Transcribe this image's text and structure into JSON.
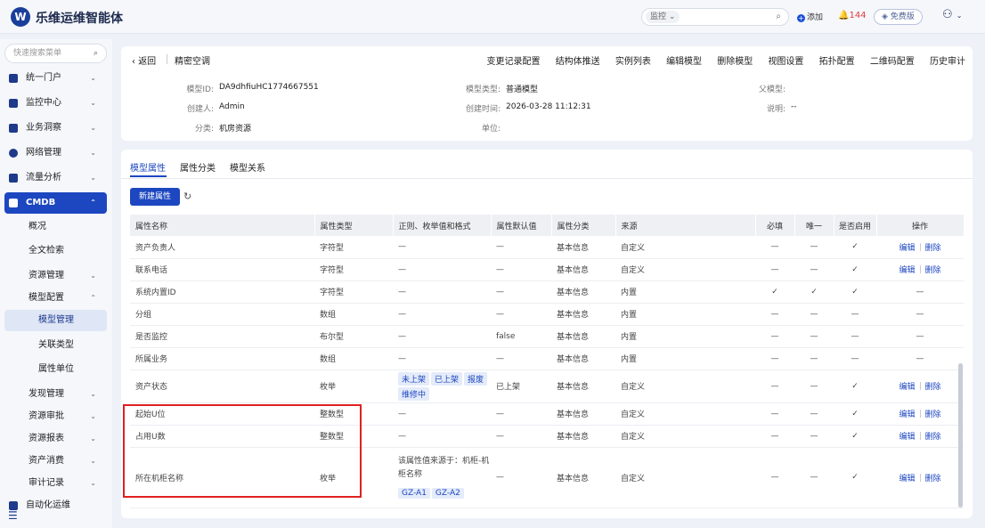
{
  "app": {
    "logo": "W",
    "title": "乐维运维智能体"
  },
  "topbar": {
    "search_select": "监控 ⌄",
    "add_label": "添加",
    "alarm_count": "144",
    "free_label": "免费版"
  },
  "sidebar": {
    "search_placeholder": "快速搜索菜单",
    "items": [
      "统一门户",
      "监控中心",
      "业务洞察",
      "网络管理",
      "流量分析",
      "CMDB"
    ],
    "sub_items": [
      "概况",
      "全文检索",
      "资源管理",
      "模型配置",
      "模型管理",
      "关联类型",
      "属性单位",
      "发现管理",
      "资源审批",
      "资源报表",
      "资产消费",
      "审计记录",
      "自动化运维"
    ]
  },
  "header": {
    "back_label": "返回",
    "title": "精密空调",
    "actions": [
      "变更记录配置",
      "结构体推送",
      "实例列表",
      "编辑模型",
      "删除模型",
      "视图设置",
      "拓扑配置",
      "二维码配置",
      "历史审计"
    ],
    "meta": {
      "model_id_label": "模型ID:",
      "model_id": "DA9dhfiuHC1774667551",
      "creator_label": "创建人:",
      "creator": "Admin",
      "category_label": "分类:",
      "category": "机房资源",
      "type_label": "模型类型:",
      "type": "普通模型",
      "created_label": "创建时间:",
      "created": "2026-03-28 11:12:31",
      "unit_label": "单位:",
      "unit": "",
      "parent_label": "父模型:",
      "parent": "",
      "desc_label": "说明:",
      "desc": "--"
    }
  },
  "tabs": [
    "模型属性",
    "属性分类",
    "模型关系"
  ],
  "new_button": "新建属性",
  "table": {
    "headers": [
      "属性名称",
      "属性类型",
      "正则、枚举值和格式",
      "属性默认值",
      "属性分类",
      "来源",
      "必填",
      "唯一",
      "是否启用",
      "操作"
    ],
    "rows": [
      {
        "name": "资产负责人",
        "type": "字符型",
        "format": "—",
        "default": "—",
        "category": "基本信息",
        "source": "自定义",
        "required": "—",
        "unique": "—",
        "enabled": "✓",
        "edit": "编辑",
        "del": "删除"
      },
      {
        "name": "联系电话",
        "type": "字符型",
        "format": "—",
        "default": "—",
        "category": "基本信息",
        "source": "自定义",
        "required": "—",
        "unique": "—",
        "enabled": "✓",
        "edit": "编辑",
        "del": "删除"
      },
      {
        "name": "系统内置ID",
        "type": "字符型",
        "format": "—",
        "default": "—",
        "category": "基本信息",
        "source": "内置",
        "required": "✓",
        "unique": "✓",
        "enabled": "✓",
        "edit": "",
        "del": "",
        "ops_dash": "—"
      },
      {
        "name": "分组",
        "type": "数组",
        "format": "—",
        "default": "—",
        "category": "基本信息",
        "source": "内置",
        "required": "—",
        "unique": "—",
        "enabled": "—",
        "edit": "",
        "del": "",
        "ops_dash": "—"
      },
      {
        "name": "是否监控",
        "type": "布尔型",
        "format": "—",
        "default": "false",
        "category": "基本信息",
        "source": "内置",
        "required": "—",
        "unique": "—",
        "enabled": "—",
        "edit": "",
        "del": "",
        "ops_dash": "—"
      },
      {
        "name": "所属业务",
        "type": "数组",
        "format": "—",
        "default": "—",
        "category": "基本信息",
        "source": "内置",
        "required": "—",
        "unique": "—",
        "enabled": "—",
        "edit": "",
        "del": "",
        "ops_dash": "—"
      },
      {
        "name": "资产状态",
        "type": "枚举",
        "tags": [
          "未上架",
          "已上架",
          "报废",
          "维修中"
        ],
        "default": "已上架",
        "category": "基本信息",
        "source": "自定义",
        "required": "—",
        "unique": "—",
        "enabled": "✓",
        "edit": "编辑",
        "del": "删除"
      },
      {
        "name": "起始U位",
        "type": "整数型",
        "format": "—",
        "default": "—",
        "category": "基本信息",
        "source": "自定义",
        "required": "—",
        "unique": "—",
        "enabled": "✓",
        "edit": "编辑",
        "del": "删除"
      },
      {
        "name": "占用U数",
        "type": "整数型",
        "format": "—",
        "default": "—",
        "category": "基本信息",
        "source": "自定义",
        "required": "—",
        "unique": "—",
        "enabled": "✓",
        "edit": "编辑",
        "del": "删除"
      },
      {
        "name": "所在机柜名称",
        "type": "枚举",
        "note": "该属性值来源于：机柜-机柜名称",
        "tags": [
          "GZ-A1",
          "GZ-A2"
        ],
        "default": "—",
        "category": "基本信息",
        "source": "自定义",
        "required": "—",
        "unique": "—",
        "enabled": "✓",
        "edit": "编辑",
        "del": "删除"
      }
    ]
  },
  "colors": {
    "primary": "#1d47c0",
    "highlight": "#e02020",
    "alarm": "#e23b3b"
  }
}
